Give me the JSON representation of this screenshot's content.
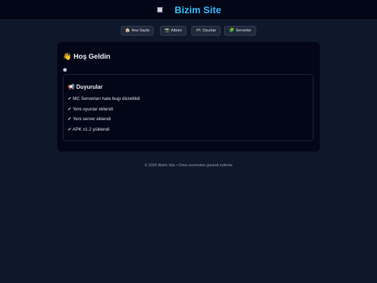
{
  "header": {
    "title": "Bizim Site",
    "logo_icon": "broken-image-icon"
  },
  "nav": {
    "items": [
      {
        "icon": "🏠",
        "icon_name": "home-icon",
        "label": "Ana Sayfa"
      },
      {
        "icon": "📸",
        "icon_name": "camera-icon",
        "label": "Albüm"
      },
      {
        "icon": "🎮",
        "icon_name": "gamepad-icon",
        "label": "Oyunlar"
      },
      {
        "icon": "🧩",
        "icon_name": "puzzle-icon",
        "label": "Serverler"
      }
    ]
  },
  "main": {
    "welcome_icon": "👋",
    "welcome_title": "Hoş Geldin",
    "announcements": {
      "icon": "📢",
      "title": "Duyurular",
      "items": [
        "✔ MC Serverları hata bugı düzeltildi",
        "✔ Yeni oyunlar eklendi",
        "✔ Yeni server eklendi",
        "✔ APK v1.2 yüklendi"
      ]
    }
  },
  "footer": {
    "text": "© 2026 Bizim Site • Drive üzerinden güvenli indirme"
  },
  "colors": {
    "background": "#0f172a",
    "header_bg": "#020617",
    "accent": "#38bdf8",
    "card_bg": "#020617",
    "nav_button_bg": "#1e293b"
  }
}
